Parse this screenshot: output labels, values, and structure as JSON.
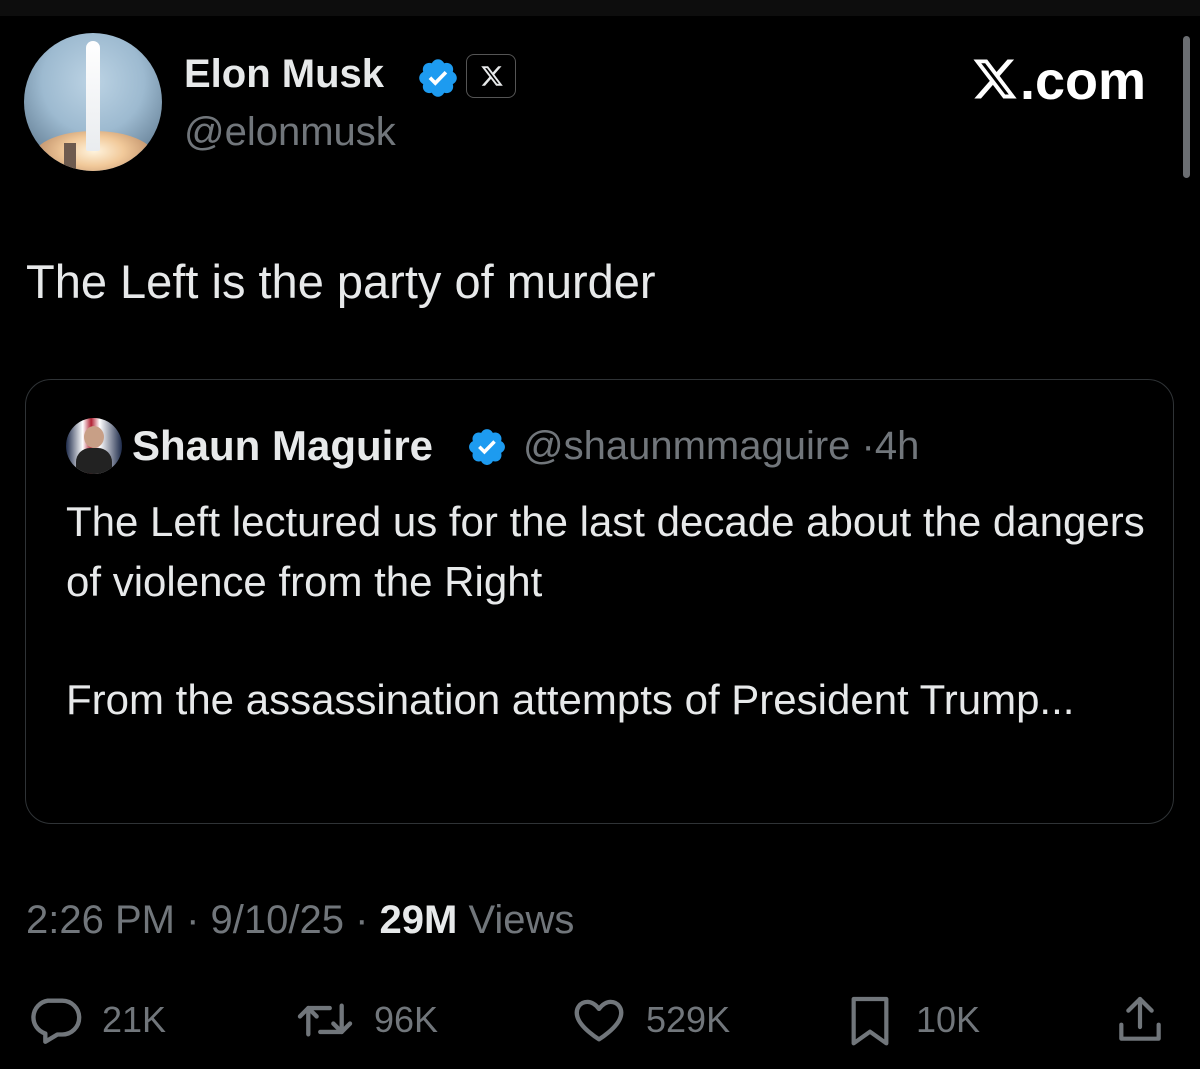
{
  "author": {
    "name": "Elon Musk",
    "handle": "@elonmusk"
  },
  "brand": {
    "suffix": ".com"
  },
  "tweet": {
    "text": "The Left is the party of murder"
  },
  "quoted": {
    "name": "Shaun Maguire",
    "handle": "@shaunmmaguire",
    "separator": "·",
    "time": "4h",
    "paragraphs": [
      "The Left lectured us for the last decade about the dangers of violence from the Right",
      "From the assassination attempts of President Trump..."
    ]
  },
  "meta": {
    "time": "2:26 PM",
    "sep1": " · ",
    "date": "9/10/25",
    "sep2": " · ",
    "views_count": "29M",
    "views_label": " Views"
  },
  "actions": {
    "replies": "21K",
    "reposts": "96K",
    "likes": "529K",
    "bookmarks": "10K"
  },
  "colors": {
    "background": "#000000",
    "text": "#e7e9ea",
    "muted": "#71767b",
    "verified": "#1d9bf0",
    "border": "#2f3336"
  },
  "icons": [
    "verified-badge-icon",
    "x-logo-icon",
    "reply-icon",
    "repost-icon",
    "like-icon",
    "bookmark-icon",
    "share-icon"
  ]
}
